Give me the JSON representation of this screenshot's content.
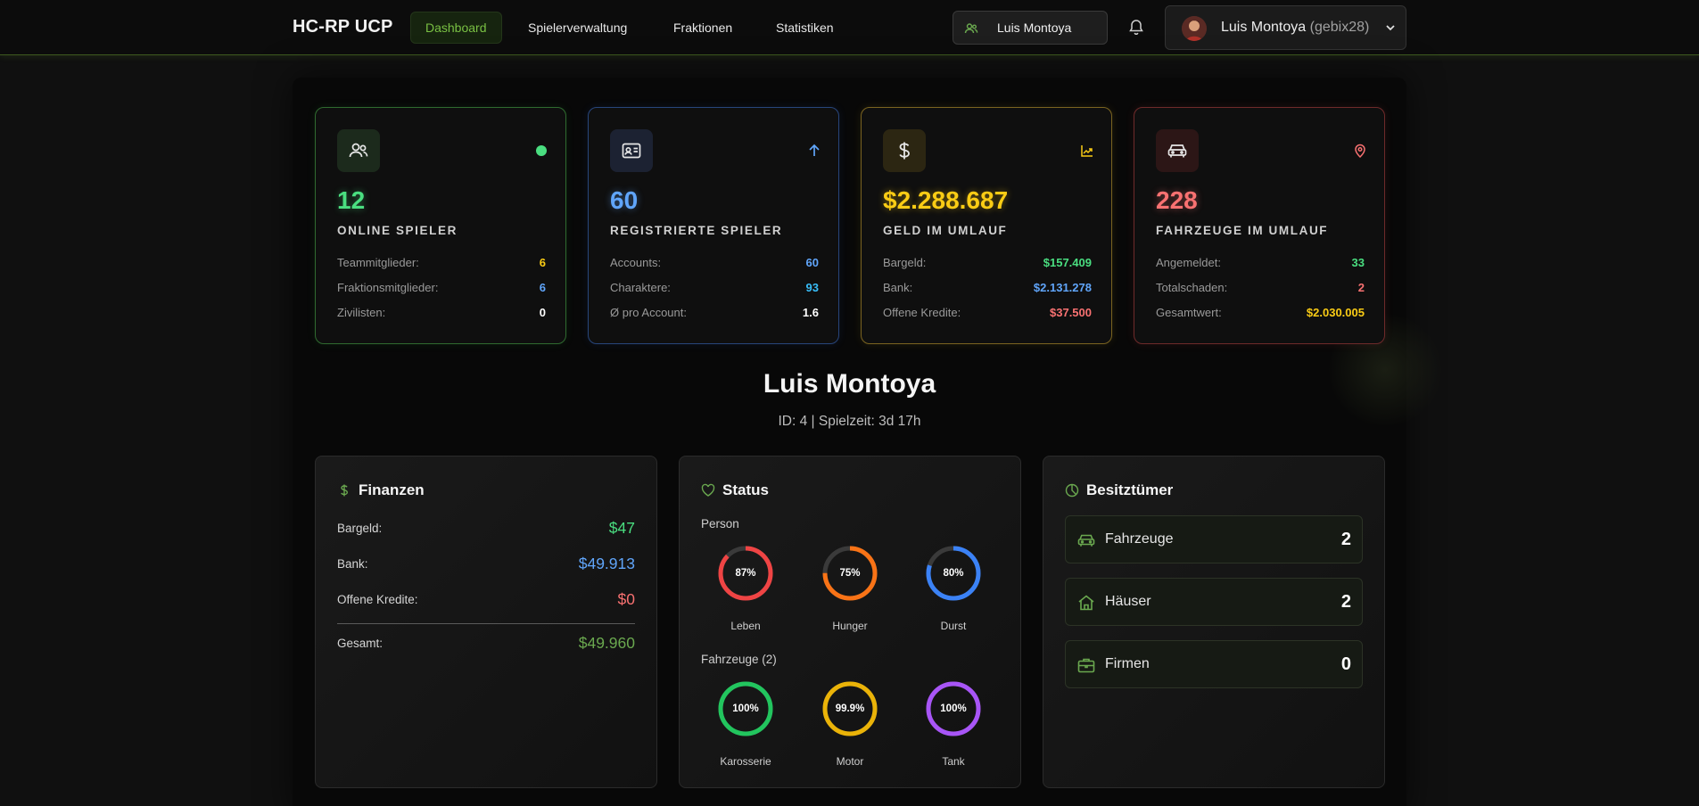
{
  "nav": {
    "brand": "HC-RP UCP",
    "items": [
      "Dashboard",
      "Spielerverwaltung",
      "Fraktionen",
      "Statistiken"
    ],
    "active": "Dashboard",
    "search_value": "Luis Montoya",
    "user_name": "Luis Montoya",
    "user_nick": "(gebix28)"
  },
  "stats": [
    {
      "value": "12",
      "label": "ONLINE SPIELER",
      "rows": [
        {
          "k": "Teammitglieder:",
          "v": "6",
          "color": "#facc15"
        },
        {
          "k": "Fraktionsmitglieder:",
          "v": "6",
          "color": "#60a5fa"
        },
        {
          "k": "Zivilisten:",
          "v": "0",
          "color": "#ffffff"
        }
      ]
    },
    {
      "value": "60",
      "label": "REGISTRIERTE SPIELER",
      "rows": [
        {
          "k": "Accounts:",
          "v": "60",
          "color": "#60a5fa"
        },
        {
          "k": "Charaktere:",
          "v": "93",
          "color": "#38bdf8"
        },
        {
          "k": "Ø pro Account:",
          "v": "1.6",
          "color": "#ffffff"
        }
      ]
    },
    {
      "value": "$2.288.687",
      "label": "GELD IM UMLAUF",
      "rows": [
        {
          "k": "Bargeld:",
          "v": "$157.409",
          "color": "#4ade80"
        },
        {
          "k": "Bank:",
          "v": "$2.131.278",
          "color": "#60a5fa"
        },
        {
          "k": "Offene Kredite:",
          "v": "$37.500",
          "color": "#f87171"
        }
      ]
    },
    {
      "value": "228",
      "label": "FAHRZEUGE IM UMLAUF",
      "rows": [
        {
          "k": "Angemeldet:",
          "v": "33",
          "color": "#4ade80"
        },
        {
          "k": "Totalschaden:",
          "v": "2",
          "color": "#f87171"
        },
        {
          "k": "Gesamtwert:",
          "v": "$2.030.005",
          "color": "#facc15"
        }
      ]
    }
  ],
  "character": {
    "name": "Luis Montoya",
    "meta": "ID: 4 | Spielzeit: 3d 17h"
  },
  "finanzen": {
    "title": "Finanzen",
    "rows": [
      {
        "k": "Bargeld:",
        "v": "$47",
        "color": "#4ade80"
      },
      {
        "k": "Bank:",
        "v": "$49.913",
        "color": "#60a5fa"
      },
      {
        "k": "Offene Kredite:",
        "v": "$0",
        "color": "#f87171"
      }
    ],
    "total_label": "Gesamt:",
    "total_value": "$49.960",
    "total_color": "#6aa84f"
  },
  "status": {
    "title": "Status",
    "person_label": "Person",
    "person": [
      {
        "label": "Leben",
        "pct": "87%",
        "value": 0.87,
        "color": "#ef4444"
      },
      {
        "label": "Hunger",
        "pct": "75%",
        "value": 0.75,
        "color": "#f97316"
      },
      {
        "label": "Durst",
        "pct": "80%",
        "value": 0.8,
        "color": "#3b82f6"
      }
    ],
    "vehicle_label": "Fahrzeuge (2)",
    "vehicle": [
      {
        "label": "Karosserie",
        "pct": "100%",
        "value": 1.0,
        "color": "#22c55e"
      },
      {
        "label": "Motor",
        "pct": "99.9%",
        "value": 0.999,
        "color": "#eab308"
      },
      {
        "label": "Tank",
        "pct": "100%",
        "value": 1.0,
        "color": "#a855f7"
      }
    ]
  },
  "besitz": {
    "title": "Besitztümer",
    "items": [
      {
        "k": "Fahrzeuge",
        "v": "2",
        "icon": "car-icon"
      },
      {
        "k": "Häuser",
        "v": "2",
        "icon": "house-icon"
      },
      {
        "k": "Firmen",
        "v": "0",
        "icon": "briefcase-icon"
      }
    ]
  },
  "colors": {
    "accent": "#79c043",
    "green": "#4ade80",
    "blue": "#60a5fa",
    "yellow": "#facc15",
    "red": "#f87171"
  }
}
